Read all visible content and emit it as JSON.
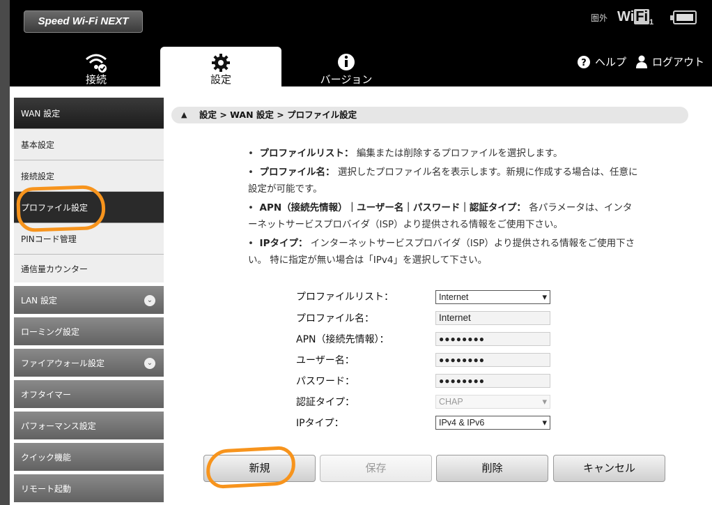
{
  "header": {
    "logo": "Speed Wi-Fi NEXT",
    "signal_text": "圏外",
    "wifi_label": "Wi",
    "wifi_label_fi": "Fi",
    "wifi_sub": "1"
  },
  "tabs": [
    {
      "label": "接続",
      "icon": "wifi-check-icon"
    },
    {
      "label": "設定",
      "icon": "gear-icon",
      "active": true
    },
    {
      "label": "バージョン",
      "icon": "info-icon"
    }
  ],
  "top_links": {
    "help": "ヘルプ",
    "logout": "ログアウト"
  },
  "sidebar": {
    "items": [
      {
        "label": "WAN 設定"
      },
      {
        "label": "基本設定"
      },
      {
        "label": "接続設定"
      },
      {
        "label": "プロファイル設定",
        "active": true
      },
      {
        "label": "PINコード管理"
      },
      {
        "label": "通信量カウンター"
      },
      {
        "label": "LAN 設定"
      },
      {
        "label": "ローミング設定"
      },
      {
        "label": "ファイアウォール設定"
      },
      {
        "label": "オフタイマー"
      },
      {
        "label": "パフォーマンス設定"
      },
      {
        "label": "クイック機能"
      },
      {
        "label": "リモート起動"
      }
    ]
  },
  "breadcrumb": "設定 > WAN 設定 > プロファイル設定",
  "description": {
    "item1_term": "プロファイルリスト：",
    "item1_text": "編集または削除するプロファイルを選択します。",
    "item2_term": "プロファイル名：",
    "item2_text": "選択したプロファイル名を表示します。新規に作成する場合は、任意に設定が可能です。",
    "item3_term": "APN（接続先情報）｜ユーザー名｜パスワード｜認証タイプ：",
    "item3_text": "各パラメータは、インターネットサービスプロバイダ（ISP）より提供される情報をご使用下さい。",
    "item4_term": "IPタイプ：",
    "item4_text": "インターネットサービスプロバイダ（ISP）より提供される情報をご使用下さい。 特に指定が無い場合は「IPv4」を選択して下さい。"
  },
  "form": {
    "profile_list_label": "プロファイルリスト：",
    "profile_list_value": "Internet",
    "profile_name_label": "プロファイル名：",
    "profile_name_value": "Internet",
    "apn_label": "APN（接続先情報）：",
    "apn_value": "●●●●●●●●",
    "username_label": "ユーザー名：",
    "username_value": "●●●●●●●●",
    "password_label": "パスワード：",
    "password_value": "●●●●●●●●",
    "auth_label": "認証タイプ：",
    "auth_value": "CHAP",
    "ip_label": "IPタイプ：",
    "ip_value": "IPv4 & IPv6"
  },
  "buttons": {
    "new": "新規",
    "save": "保存",
    "delete": "削除",
    "cancel": "キャンセル"
  },
  "colors": {
    "annotation": "#f7941d",
    "header_bg": "#000000"
  }
}
